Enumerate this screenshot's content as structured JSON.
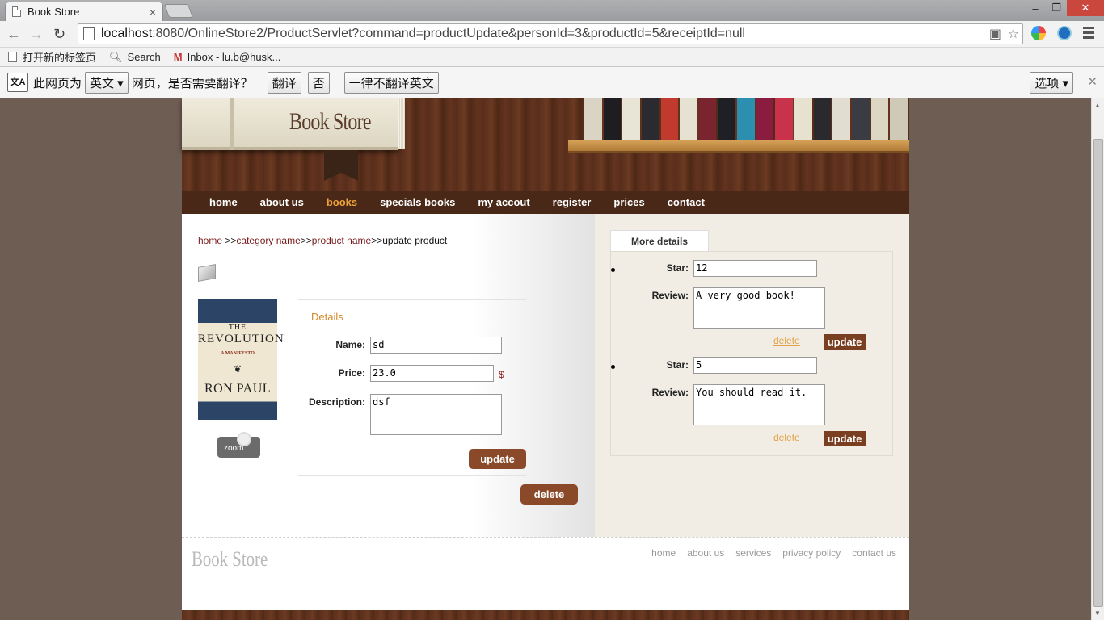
{
  "browser": {
    "tab_title": "Book Store",
    "tab_close": "×",
    "url_host": "localhost",
    "url_rest": ":8080/OnlineStore2/ProductServlet?command=productUpdate&personId=3&productId=5&receiptId=null",
    "win_min": "–",
    "win_max": "❐",
    "win_close": "✕",
    "ext_badge": "2"
  },
  "bookmarks": [
    {
      "label": "打开新的标签页"
    },
    {
      "label": "Search"
    },
    {
      "label": "Inbox - lu.b@husk..."
    }
  ],
  "translate_bar": {
    "icon_text": "文A",
    "prefix": "此网页为",
    "language": "英文 ▾",
    "question": "网页，是否需要翻译？",
    "translate": "翻译",
    "no": "否",
    "never": "一律不翻译英文",
    "options": "选项 ▾",
    "close": "✕"
  },
  "site": {
    "logo": "Book Store",
    "menu": [
      "home",
      "about us",
      "books",
      "specials books",
      "my accout",
      "register",
      "prices",
      "contact"
    ],
    "active_menu": "books"
  },
  "breadcrumb": {
    "home": "home",
    "sep1": " >>",
    "category": "category name",
    "sep2": ">>",
    "product": "product name",
    "sep3": ">>",
    "current": "update product"
  },
  "cover": {
    "line1": "THE",
    "line2": "REVOLUTION",
    "line3": "A MANIFESTO",
    "author": "RON PAUL",
    "zoom": "zoom"
  },
  "details": {
    "heading": "Details",
    "name_label": "Name:",
    "name_value": "sd",
    "price_label": "Price:",
    "price_value": "23.0",
    "currency": "$",
    "desc_label": "Description:",
    "desc_value": "dsf",
    "update": "update",
    "delete": "delete"
  },
  "more_details": {
    "tab": "More details",
    "reviews": [
      {
        "star_label": "Star:",
        "star": "12",
        "review_label": "Review:",
        "review": "A very good book!",
        "delete": "delete",
        "update": "update"
      },
      {
        "star_label": "Star:",
        "star": "5",
        "review_label": "Review:",
        "review": "You should read it.",
        "delete": "delete",
        "update": "update"
      }
    ]
  },
  "footer": {
    "logo": "Book Store",
    "links": [
      "home",
      "about us",
      "services",
      "privacy policy",
      "contact us"
    ]
  },
  "colors": {
    "accent": "#f0a23a",
    "button": "#8a4a2a",
    "menu_bg": "#4a2818"
  }
}
